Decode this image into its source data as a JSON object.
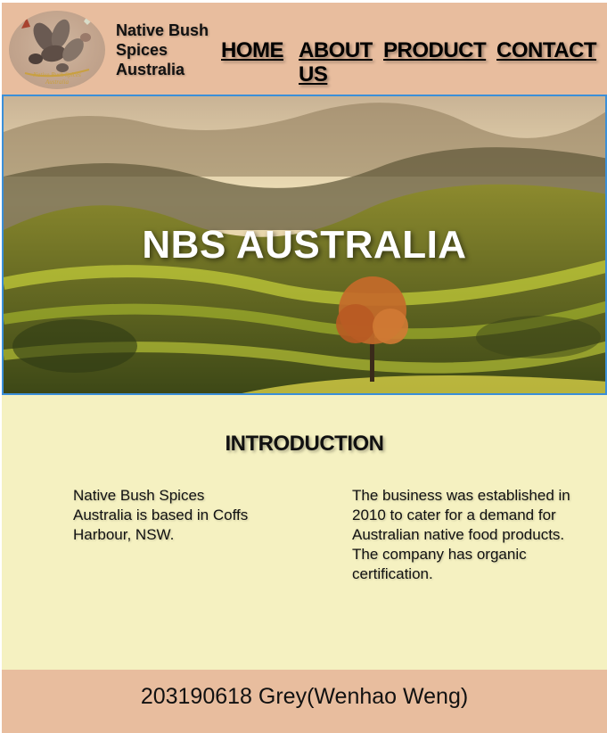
{
  "header": {
    "brand_name": "Native Bush Spices Australia",
    "logo_text": "Native Bush Spices Australia",
    "nav": [
      {
        "label": "HOME"
      },
      {
        "label": "ABOUT US"
      },
      {
        "label": "PRODUCT"
      },
      {
        "label": "CONTACT"
      }
    ]
  },
  "hero": {
    "title": "NBS AUSTRALIA",
    "border_color": "#3b8fd8"
  },
  "intro": {
    "heading": "INTRODUCTION",
    "left_text": "Native Bush Spices Australia is based in Coffs Harbour, NSW.",
    "right_text": "The business was established in 2010 to cater for a demand for Australian native food products. The company has organic certification."
  },
  "footer": {
    "text": "203190618 Grey(Wenhao Weng)"
  },
  "colors": {
    "header_bg": "#e8bd9e",
    "intro_bg": "#f5f1c1",
    "footer_bg": "#e8bd9e"
  }
}
